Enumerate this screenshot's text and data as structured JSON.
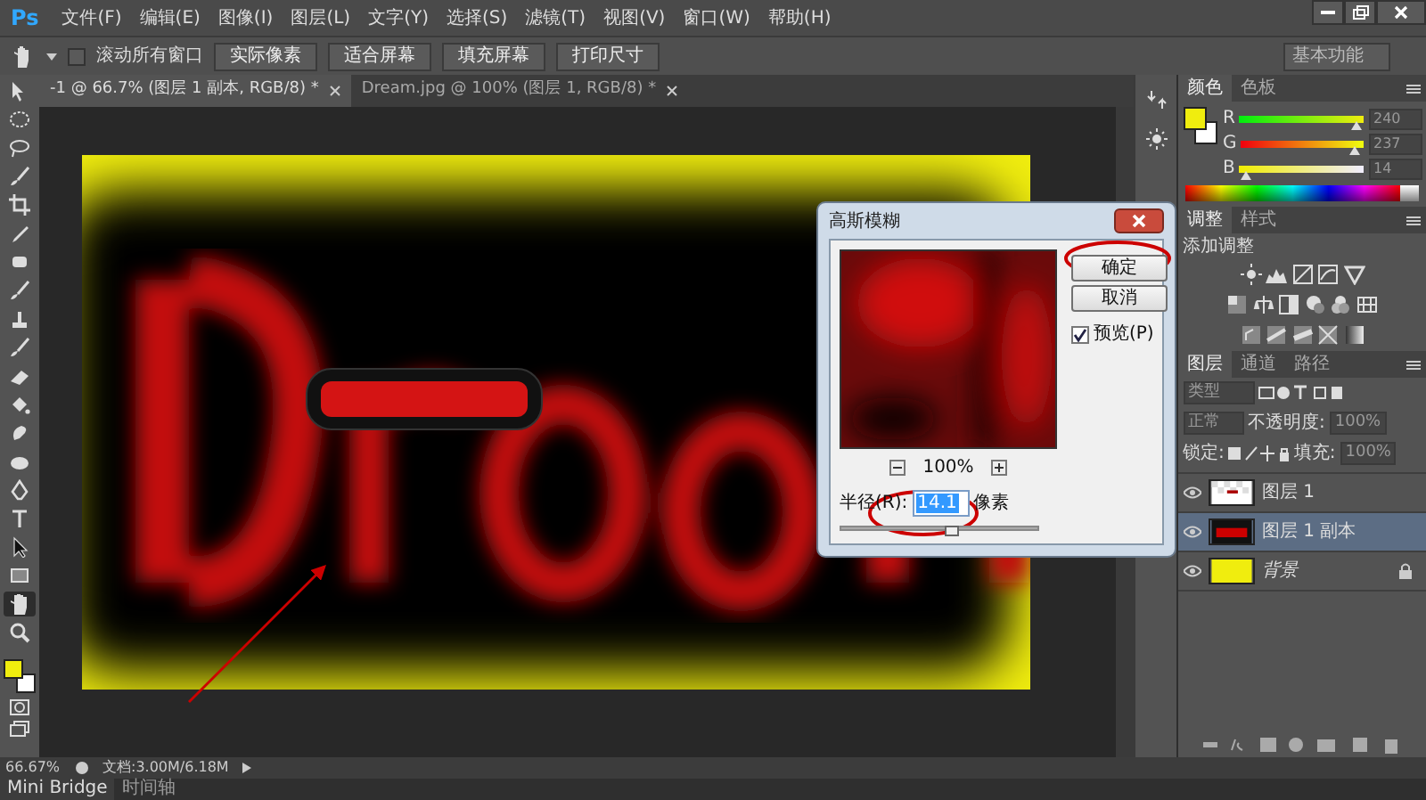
{
  "menu": {
    "logo": "Ps",
    "items": [
      "文件(F)",
      "编辑(E)",
      "图像(I)",
      "图层(L)",
      "文字(Y)",
      "选择(S)",
      "滤镜(T)",
      "视图(V)",
      "窗口(W)",
      "帮助(H)"
    ]
  },
  "options_bar": {
    "scroll_all": {
      "label": "滚动所有窗口",
      "checked": false
    },
    "buttons": [
      "实际像素",
      "适合屏幕",
      "填充屏幕",
      "打印尺寸"
    ],
    "workspace": "基本功能"
  },
  "doc_tabs": [
    {
      "title": "-1 @ 66.7% (图层 1 副本, RGB/8) *",
      "selected": true
    },
    {
      "title": "Dream.jpg @ 100% (图层 1, RGB/8) *",
      "selected": false
    }
  ],
  "tools": [
    {
      "kind": "move",
      "selected": false
    },
    {
      "kind": "marquee",
      "selected": false
    },
    {
      "kind": "lasso",
      "selected": false
    },
    {
      "kind": "brush",
      "selected": false
    },
    {
      "kind": "crop",
      "selected": false
    },
    {
      "kind": "eyedropper",
      "selected": false
    },
    {
      "kind": "patch",
      "selected": false
    },
    {
      "kind": "brush",
      "selected": false
    },
    {
      "kind": "stamp",
      "selected": false
    },
    {
      "kind": "brush",
      "selected": false
    },
    {
      "kind": "eraser",
      "selected": false
    },
    {
      "kind": "bucket",
      "selected": false
    },
    {
      "kind": "drop",
      "selected": false
    },
    {
      "kind": "sponge",
      "selected": false
    },
    {
      "kind": "pen",
      "selected": false
    },
    {
      "kind": "type",
      "selected": false
    },
    {
      "kind": "arrow",
      "selected": false
    },
    {
      "kind": "rectangle",
      "selected": false
    },
    {
      "kind": "hand",
      "selected": true
    },
    {
      "kind": "zoom",
      "selected": false
    }
  ],
  "tool_swatches": [
    {
      "kind": "foreground",
      "color": "#f0ed0e"
    },
    {
      "kind": "background",
      "color": "#ffffff"
    }
  ],
  "dialog": {
    "title": "高斯模糊",
    "ok": "确定",
    "cancel": "取消",
    "preview": {
      "label": "预览(P)",
      "checked": true
    },
    "zoom": "100%",
    "radius": {
      "label": "半径(R):",
      "value": "14.1",
      "unit": "像素",
      "level": 0.56
    }
  },
  "color_panel": {
    "tabs": [
      {
        "label": "颜色",
        "selected": true
      },
      {
        "label": "色板",
        "selected": false
      }
    ],
    "swatches": [
      {
        "kind": "foreground",
        "color": "#f0ed0e"
      },
      {
        "kind": "background",
        "color": "#ffffff"
      }
    ],
    "channels": [
      {
        "name": "R",
        "value": "240",
        "level": 0.94
      },
      {
        "name": "G",
        "value": "237",
        "level": 0.93
      },
      {
        "name": "B",
        "value": "14",
        "level": 0.05
      }
    ]
  },
  "adjustments_panel": {
    "tabs": [
      {
        "label": "调整",
        "selected": true
      },
      {
        "label": "样式",
        "selected": false
      }
    ],
    "heading": "添加调整"
  },
  "layers_panel": {
    "tabs": [
      {
        "label": "图层",
        "selected": true
      },
      {
        "label": "通道",
        "selected": false
      },
      {
        "label": "路径",
        "selected": false
      }
    ],
    "filter": "类型",
    "blend": "正常",
    "opacity_label": "不透明度:",
    "opacity": "100%",
    "lock_label": "锁定:",
    "fill_label": "填充:",
    "fill": "100%",
    "layers": [
      {
        "name": "图层 1",
        "kind": "transparent",
        "visible": true,
        "selected": false,
        "locked": false
      },
      {
        "name": "图层 1 副本",
        "kind": "dream",
        "visible": true,
        "selected": true,
        "locked": false
      },
      {
        "name": "背景",
        "kind": "background",
        "visible": true,
        "selected": false,
        "locked": true
      }
    ]
  },
  "status_bar": {
    "zoom": "66.67%",
    "doc_info": "文档:3.00M/6.18M"
  },
  "bottom_tabs": [
    {
      "label": "Mini Bridge",
      "selected": true
    },
    {
      "label": "时间轴",
      "selected": false
    }
  ]
}
